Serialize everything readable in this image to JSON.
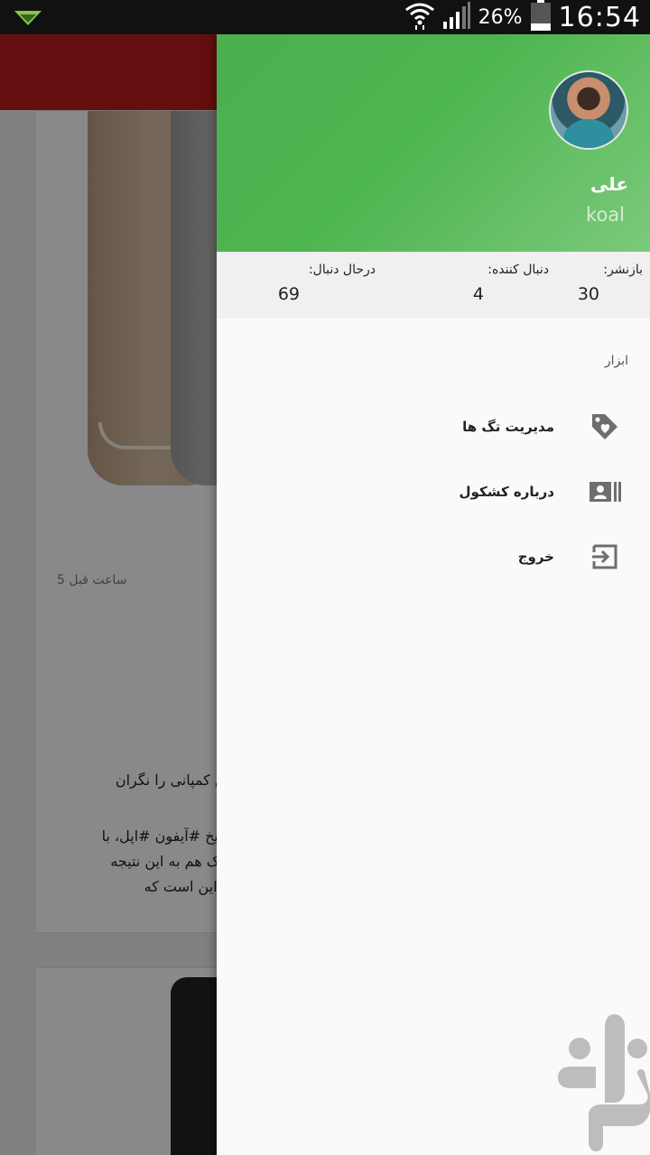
{
  "status_bar": {
    "battery_percent": "26%",
    "time": "16:54",
    "icons": [
      "notification-icon",
      "wifi-icon",
      "signal-icon",
      "battery-icon"
    ]
  },
  "background_feed": {
    "post_time": "5 ساعت قبل",
    "text_lines": [
      "این کمپانی را نگران",
      "تاریخ #آیفون #اپل، با",
      "کوک هم به این نتیجه",
      "بر این است که"
    ]
  },
  "drawer": {
    "header": {
      "user_name": "علی",
      "username": "koal"
    },
    "stats": [
      {
        "label": "بازنشر:",
        "value": "30"
      },
      {
        "label": "دنبال کننده:",
        "value": "4"
      },
      {
        "label": "درحال دنبال:",
        "value": "69"
      }
    ],
    "section_title": "ابزار",
    "menu": [
      {
        "label": "مدیریت تگ ها",
        "icon": "tag-heart-icon"
      },
      {
        "label": "درباره کشکول",
        "icon": "contact-card-icon"
      },
      {
        "label": "خروج",
        "icon": "exit-icon"
      }
    ]
  },
  "colors": {
    "header_green": "#4caf50",
    "toolbar_red": "#b71c1c",
    "drawer_bg": "#fafafa"
  }
}
